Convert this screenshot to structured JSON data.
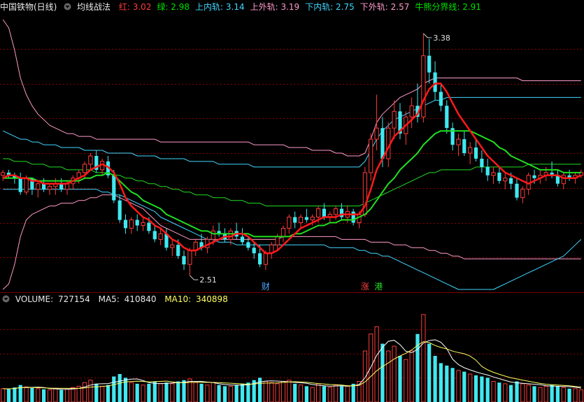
{
  "header": {
    "stock_name": "中国铁物(日线)",
    "indicator_name": "均线战法",
    "values": [
      {
        "label": "红:",
        "value": "3.02",
        "color": "#ff3c3c"
      },
      {
        "label": "绿:",
        "value": "2.98",
        "color": "#00e000"
      },
      {
        "label": "上内轨:",
        "value": "3.14",
        "color": "#40d8ff"
      },
      {
        "label": "上外轨:",
        "value": "3.19",
        "color": "#ff9ac8"
      },
      {
        "label": "下内轨:",
        "value": "2.75",
        "color": "#40d8ff"
      },
      {
        "label": "下外轨:",
        "value": "2.57",
        "color": "#ff9ac8"
      },
      {
        "label": "牛熊分界线:",
        "value": "2.91",
        "color": "#00e000"
      }
    ]
  },
  "annotations": {
    "high_label": "3.38",
    "low_label": "2.51",
    "marker_cai": "财",
    "marker_zhang": "涨",
    "marker_gang": "港"
  },
  "volume_header": {
    "volume_label": "VOLUME:",
    "volume_value": "727154",
    "ma5_label": "MA5:",
    "ma5_value": "410840",
    "ma10_label": "MA10:",
    "ma10_value": "340898"
  },
  "colors": {
    "up": "#ff3c3c",
    "down": "#40e8f0",
    "red_ma": "#ff1a1a",
    "green_ma": "#20e020",
    "inner_band": "#40d8ff",
    "outer_band": "#ff9ac8",
    "grid": "#8a0000",
    "vol_ma5": "#ffffff",
    "vol_ma10": "#ffff60"
  },
  "chart_data": {
    "type": "candlestick",
    "price_range": [
      2.45,
      3.45
    ],
    "volume_range": [
      0,
      800000
    ],
    "candles": [
      [
        2.87,
        2.89,
        2.85,
        2.88,
        110000
      ],
      [
        2.88,
        2.89,
        2.86,
        2.87,
        105000
      ],
      [
        2.87,
        2.88,
        2.84,
        2.86,
        120000
      ],
      [
        2.86,
        2.88,
        2.8,
        2.81,
        140000
      ],
      [
        2.81,
        2.87,
        2.8,
        2.86,
        125000
      ],
      [
        2.86,
        2.86,
        2.8,
        2.82,
        115000
      ],
      [
        2.82,
        2.85,
        2.79,
        2.84,
        110000
      ],
      [
        2.84,
        2.86,
        2.81,
        2.82,
        105000
      ],
      [
        2.82,
        2.84,
        2.8,
        2.83,
        100000
      ],
      [
        2.83,
        2.86,
        2.8,
        2.84,
        110000
      ],
      [
        2.84,
        2.86,
        2.81,
        2.82,
        100000
      ],
      [
        2.82,
        2.85,
        2.8,
        2.84,
        105000
      ],
      [
        2.84,
        2.87,
        2.82,
        2.86,
        120000
      ],
      [
        2.86,
        2.89,
        2.84,
        2.88,
        130000
      ],
      [
        2.88,
        2.92,
        2.86,
        2.91,
        160000
      ],
      [
        2.91,
        2.95,
        2.89,
        2.94,
        180000
      ],
      [
        2.94,
        2.96,
        2.88,
        2.89,
        150000
      ],
      [
        2.89,
        2.93,
        2.87,
        2.92,
        130000
      ],
      [
        2.92,
        2.94,
        2.86,
        2.87,
        140000
      ],
      [
        2.87,
        2.89,
        2.77,
        2.78,
        210000
      ],
      [
        2.78,
        2.8,
        2.7,
        2.71,
        230000
      ],
      [
        2.71,
        2.73,
        2.66,
        2.68,
        200000
      ],
      [
        2.68,
        2.72,
        2.66,
        2.71,
        160000
      ],
      [
        2.71,
        2.73,
        2.67,
        2.69,
        150000
      ],
      [
        2.69,
        2.72,
        2.67,
        2.7,
        140000
      ],
      [
        2.7,
        2.72,
        2.66,
        2.67,
        150000
      ],
      [
        2.67,
        2.69,
        2.63,
        2.64,
        170000
      ],
      [
        2.64,
        2.68,
        2.62,
        2.66,
        150000
      ],
      [
        2.66,
        2.68,
        2.6,
        2.61,
        160000
      ],
      [
        2.61,
        2.64,
        2.58,
        2.62,
        150000
      ],
      [
        2.62,
        2.64,
        2.57,
        2.58,
        170000
      ],
      [
        2.58,
        2.6,
        2.53,
        2.55,
        180000
      ],
      [
        2.55,
        2.61,
        2.51,
        2.6,
        190000
      ],
      [
        2.6,
        2.64,
        2.58,
        2.63,
        160000
      ],
      [
        2.63,
        2.66,
        2.6,
        2.61,
        150000
      ],
      [
        2.61,
        2.65,
        2.59,
        2.64,
        140000
      ],
      [
        2.64,
        2.69,
        2.62,
        2.67,
        160000
      ],
      [
        2.67,
        2.7,
        2.65,
        2.66,
        140000
      ],
      [
        2.66,
        2.68,
        2.63,
        2.64,
        130000
      ],
      [
        2.64,
        2.68,
        2.62,
        2.67,
        130000
      ],
      [
        2.67,
        2.7,
        2.64,
        2.65,
        140000
      ],
      [
        2.65,
        2.68,
        2.62,
        2.63,
        150000
      ],
      [
        2.63,
        2.65,
        2.6,
        2.61,
        160000
      ],
      [
        2.61,
        2.63,
        2.57,
        2.59,
        180000
      ],
      [
        2.59,
        2.62,
        2.54,
        2.55,
        200000
      ],
      [
        2.55,
        2.6,
        2.53,
        2.59,
        170000
      ],
      [
        2.59,
        2.63,
        2.57,
        2.62,
        160000
      ],
      [
        2.62,
        2.66,
        2.6,
        2.65,
        150000
      ],
      [
        2.65,
        2.69,
        2.63,
        2.68,
        170000
      ],
      [
        2.68,
        2.73,
        2.66,
        2.72,
        180000
      ],
      [
        2.72,
        2.74,
        2.68,
        2.7,
        150000
      ],
      [
        2.7,
        2.73,
        2.68,
        2.72,
        140000
      ],
      [
        2.72,
        2.75,
        2.7,
        2.71,
        130000
      ],
      [
        2.71,
        2.73,
        2.69,
        2.72,
        120000
      ],
      [
        2.72,
        2.76,
        2.7,
        2.75,
        150000
      ],
      [
        2.75,
        2.77,
        2.71,
        2.72,
        130000
      ],
      [
        2.72,
        2.74,
        2.7,
        2.73,
        120000
      ],
      [
        2.73,
        2.76,
        2.71,
        2.75,
        140000
      ],
      [
        2.75,
        2.77,
        2.71,
        2.72,
        130000
      ],
      [
        2.72,
        2.76,
        2.7,
        2.74,
        130000
      ],
      [
        2.74,
        2.75,
        2.69,
        2.7,
        150000
      ],
      [
        2.7,
        2.74,
        2.68,
        2.73,
        170000
      ],
      [
        2.73,
        2.9,
        2.72,
        2.88,
        420000
      ],
      [
        2.88,
        3.02,
        2.85,
        3.0,
        560000
      ],
      [
        3.0,
        3.16,
        2.96,
        3.04,
        620000
      ],
      [
        3.04,
        3.08,
        2.9,
        2.93,
        480000
      ],
      [
        2.93,
        3.06,
        2.9,
        3.04,
        420000
      ],
      [
        3.04,
        3.14,
        3.0,
        3.1,
        460000
      ],
      [
        3.1,
        3.13,
        3.0,
        3.02,
        380000
      ],
      [
        3.02,
        3.1,
        2.98,
        3.08,
        350000
      ],
      [
        3.08,
        3.15,
        3.04,
        3.12,
        420000
      ],
      [
        3.12,
        3.2,
        3.06,
        3.08,
        560000
      ],
      [
        3.08,
        3.38,
        3.06,
        3.3,
        720000
      ],
      [
        3.3,
        3.36,
        3.2,
        3.24,
        480000
      ],
      [
        3.24,
        3.28,
        3.14,
        3.17,
        380000
      ],
      [
        3.17,
        3.2,
        3.1,
        3.12,
        320000
      ],
      [
        3.12,
        3.14,
        3.02,
        3.04,
        300000
      ],
      [
        3.04,
        3.06,
        2.96,
        2.98,
        280000
      ],
      [
        2.98,
        3.02,
        2.94,
        3.0,
        260000
      ],
      [
        3.0,
        3.03,
        2.94,
        2.95,
        250000
      ],
      [
        2.95,
        2.99,
        2.91,
        2.97,
        230000
      ],
      [
        2.97,
        3.0,
        2.92,
        2.93,
        220000
      ],
      [
        2.93,
        2.96,
        2.88,
        2.9,
        210000
      ],
      [
        2.9,
        2.93,
        2.85,
        2.87,
        200000
      ],
      [
        2.87,
        2.9,
        2.84,
        2.88,
        170000
      ],
      [
        2.88,
        2.9,
        2.84,
        2.85,
        160000
      ],
      [
        2.85,
        2.88,
        2.82,
        2.86,
        150000
      ],
      [
        2.86,
        2.88,
        2.82,
        2.84,
        140000
      ],
      [
        2.84,
        2.86,
        2.78,
        2.79,
        170000
      ],
      [
        2.79,
        2.83,
        2.77,
        2.82,
        150000
      ],
      [
        2.82,
        2.88,
        2.8,
        2.87,
        140000
      ],
      [
        2.87,
        2.89,
        2.84,
        2.86,
        130000
      ],
      [
        2.86,
        2.89,
        2.84,
        2.87,
        120000
      ],
      [
        2.87,
        2.9,
        2.85,
        2.88,
        130000
      ],
      [
        2.88,
        2.92,
        2.86,
        2.87,
        140000
      ],
      [
        2.87,
        2.89,
        2.83,
        2.84,
        130000
      ],
      [
        2.84,
        2.88,
        2.82,
        2.87,
        120000
      ],
      [
        2.87,
        2.89,
        2.85,
        2.86,
        110000
      ],
      [
        2.86,
        2.88,
        2.84,
        2.87,
        110000
      ],
      [
        2.87,
        2.89,
        2.86,
        2.88,
        100000
      ]
    ],
    "red_ma": [
      2.86,
      2.87,
      2.87,
      2.86,
      2.86,
      2.85,
      2.85,
      2.84,
      2.84,
      2.84,
      2.84,
      2.84,
      2.85,
      2.86,
      2.87,
      2.89,
      2.9,
      2.91,
      2.9,
      2.88,
      2.84,
      2.79,
      2.76,
      2.74,
      2.72,
      2.71,
      2.69,
      2.68,
      2.66,
      2.64,
      2.63,
      2.61,
      2.6,
      2.6,
      2.61,
      2.62,
      2.63,
      2.64,
      2.65,
      2.65,
      2.66,
      2.66,
      2.65,
      2.63,
      2.61,
      2.59,
      2.59,
      2.6,
      2.62,
      2.64,
      2.66,
      2.68,
      2.69,
      2.7,
      2.71,
      2.72,
      2.72,
      2.72,
      2.73,
      2.73,
      2.73,
      2.73,
      2.76,
      2.82,
      2.89,
      2.93,
      2.97,
      3.01,
      3.03,
      3.05,
      3.07,
      3.09,
      3.14,
      3.18,
      3.2,
      3.2,
      3.17,
      3.13,
      3.09,
      3.06,
      3.03,
      3.0,
      2.97,
      2.94,
      2.92,
      2.9,
      2.88,
      2.87,
      2.86,
      2.85,
      2.84,
      2.85,
      2.86,
      2.87,
      2.87,
      2.87,
      2.86,
      2.86,
      2.86,
      2.87
    ],
    "green_ma": [
      2.86,
      2.86,
      2.86,
      2.86,
      2.86,
      2.86,
      2.85,
      2.85,
      2.85,
      2.85,
      2.85,
      2.85,
      2.85,
      2.85,
      2.86,
      2.86,
      2.87,
      2.87,
      2.88,
      2.87,
      2.85,
      2.83,
      2.81,
      2.8,
      2.78,
      2.77,
      2.76,
      2.75,
      2.73,
      2.72,
      2.71,
      2.7,
      2.69,
      2.68,
      2.67,
      2.67,
      2.66,
      2.66,
      2.66,
      2.66,
      2.66,
      2.66,
      2.66,
      2.65,
      2.65,
      2.65,
      2.65,
      2.65,
      2.65,
      2.65,
      2.66,
      2.66,
      2.67,
      2.68,
      2.69,
      2.69,
      2.7,
      2.7,
      2.71,
      2.71,
      2.71,
      2.72,
      2.73,
      2.75,
      2.78,
      2.81,
      2.84,
      2.86,
      2.89,
      2.91,
      2.93,
      2.95,
      2.98,
      3.0,
      3.02,
      3.03,
      3.03,
      3.03,
      3.03,
      3.03,
      3.03,
      3.02,
      3.01,
      3.0,
      2.99,
      2.97,
      2.96,
      2.94,
      2.93,
      2.92,
      2.91,
      2.9,
      2.89,
      2.89,
      2.89,
      2.89,
      2.88,
      2.88,
      2.88,
      2.88
    ],
    "upper_outer_band": [
      3.43,
      3.4,
      3.32,
      3.22,
      3.16,
      3.12,
      3.09,
      3.07,
      3.05,
      3.04,
      3.03,
      3.02,
      3.02,
      3.01,
      3.01,
      3.01,
      3.0,
      3.0,
      3.0,
      3.0,
      3.0,
      3.0,
      3.0,
      3.0,
      3.0,
      3.0,
      3.0,
      2.99,
      2.99,
      2.99,
      2.99,
      2.99,
      2.99,
      2.99,
      2.99,
      2.99,
      2.99,
      2.99,
      2.99,
      2.99,
      2.99,
      2.99,
      2.99,
      2.98,
      2.98,
      2.98,
      2.98,
      2.98,
      2.98,
      2.97,
      2.97,
      2.97,
      2.97,
      2.96,
      2.96,
      2.96,
      2.96,
      2.95,
      2.95,
      2.94,
      2.94,
      2.94,
      2.95,
      3.0,
      3.06,
      3.09,
      3.11,
      3.13,
      3.15,
      3.16,
      3.17,
      3.18,
      3.2,
      3.21,
      3.22,
      3.22,
      3.22,
      3.22,
      3.22,
      3.22,
      3.22,
      3.22,
      3.22,
      3.22,
      3.22,
      3.22,
      3.22,
      3.22,
      3.22,
      3.21,
      3.21,
      3.21,
      3.21,
      3.21,
      3.21,
      3.21,
      3.21,
      3.21,
      3.21,
      3.21
    ],
    "upper_inner_band": [
      3.03,
      3.02,
      3.01,
      3.0,
      3.0,
      2.99,
      2.99,
      2.98,
      2.98,
      2.98,
      2.97,
      2.97,
      2.97,
      2.97,
      2.96,
      2.96,
      2.96,
      2.96,
      2.95,
      2.95,
      2.95,
      2.95,
      2.95,
      2.94,
      2.94,
      2.94,
      2.94,
      2.93,
      2.93,
      2.93,
      2.93,
      2.93,
      2.92,
      2.92,
      2.92,
      2.92,
      2.92,
      2.91,
      2.91,
      2.91,
      2.91,
      2.91,
      2.91,
      2.9,
      2.9,
      2.9,
      2.9,
      2.9,
      2.9,
      2.9,
      2.9,
      2.9,
      2.9,
      2.9,
      2.9,
      2.9,
      2.9,
      2.9,
      2.9,
      2.9,
      2.9,
      2.9,
      2.92,
      2.96,
      3.0,
      3.03,
      3.05,
      3.07,
      3.08,
      3.09,
      3.1,
      3.11,
      3.12,
      3.13,
      3.14,
      3.14,
      3.15,
      3.15,
      3.15,
      3.15,
      3.15,
      3.15,
      3.15,
      3.15,
      3.15,
      3.15,
      3.15,
      3.15,
      3.15,
      3.15,
      3.15,
      3.15,
      3.15,
      3.15,
      3.15,
      3.15,
      3.15,
      3.15,
      3.15,
      3.15
    ],
    "lower_inner_band": [
      2.82,
      2.82,
      2.82,
      2.82,
      2.82,
      2.82,
      2.82,
      2.82,
      2.82,
      2.82,
      2.82,
      2.82,
      2.82,
      2.82,
      2.82,
      2.82,
      2.82,
      2.81,
      2.81,
      2.8,
      2.8,
      2.79,
      2.78,
      2.77,
      2.76,
      2.75,
      2.74,
      2.72,
      2.71,
      2.7,
      2.69,
      2.68,
      2.67,
      2.66,
      2.65,
      2.64,
      2.64,
      2.63,
      2.63,
      2.63,
      2.62,
      2.62,
      2.62,
      2.62,
      2.62,
      2.62,
      2.62,
      2.62,
      2.62,
      2.62,
      2.62,
      2.62,
      2.62,
      2.62,
      2.62,
      2.62,
      2.61,
      2.61,
      2.61,
      2.61,
      2.61,
      2.6,
      2.6,
      2.59,
      2.59,
      2.58,
      2.58,
      2.57,
      2.56,
      2.55,
      2.54,
      2.53,
      2.52,
      2.51,
      2.5,
      2.49,
      2.48,
      2.47,
      2.46,
      2.46,
      2.46,
      2.46,
      2.46,
      2.46,
      2.46,
      2.47,
      2.48,
      2.49,
      2.5,
      2.51,
      2.52,
      2.53,
      2.54,
      2.55,
      2.56,
      2.57,
      2.58,
      2.6,
      2.62,
      2.64
    ],
    "lower_outer_band": [
      2.46,
      2.48,
      2.55,
      2.65,
      2.71,
      2.73,
      2.74,
      2.75,
      2.76,
      2.76,
      2.77,
      2.77,
      2.77,
      2.78,
      2.78,
      2.79,
      2.79,
      2.8,
      2.8,
      2.8,
      2.79,
      2.78,
      2.77,
      2.76,
      2.75,
      2.73,
      2.71,
      2.69,
      2.68,
      2.67,
      2.66,
      2.65,
      2.64,
      2.64,
      2.64,
      2.64,
      2.64,
      2.64,
      2.64,
      2.64,
      2.64,
      2.64,
      2.64,
      2.64,
      2.64,
      2.64,
      2.64,
      2.64,
      2.65,
      2.65,
      2.65,
      2.65,
      2.65,
      2.65,
      2.65,
      2.65,
      2.65,
      2.65,
      2.64,
      2.64,
      2.64,
      2.64,
      2.64,
      2.63,
      2.63,
      2.63,
      2.63,
      2.62,
      2.62,
      2.62,
      2.61,
      2.61,
      2.61,
      2.6,
      2.6,
      2.59,
      2.59,
      2.58,
      2.58,
      2.57,
      2.57,
      2.57,
      2.57,
      2.57,
      2.57,
      2.57,
      2.57,
      2.57,
      2.57,
      2.57,
      2.57,
      2.57,
      2.57,
      2.57,
      2.57,
      2.57,
      2.57,
      2.57,
      2.57,
      2.57
    ],
    "bull_bear_line": [
      2.93,
      2.93,
      2.92,
      2.92,
      2.92,
      2.91,
      2.91,
      2.91,
      2.9,
      2.9,
      2.9,
      2.89,
      2.89,
      2.89,
      2.89,
      2.89,
      2.88,
      2.88,
      2.88,
      2.87,
      2.87,
      2.86,
      2.86,
      2.85,
      2.85,
      2.84,
      2.84,
      2.83,
      2.83,
      2.82,
      2.82,
      2.81,
      2.81,
      2.8,
      2.8,
      2.8,
      2.79,
      2.79,
      2.79,
      2.78,
      2.78,
      2.78,
      2.77,
      2.77,
      2.77,
      2.76,
      2.76,
      2.76,
      2.76,
      2.76,
      2.76,
      2.76,
      2.76,
      2.76,
      2.76,
      2.76,
      2.76,
      2.76,
      2.76,
      2.76,
      2.76,
      2.76,
      2.77,
      2.78,
      2.79,
      2.8,
      2.81,
      2.82,
      2.83,
      2.84,
      2.85,
      2.86,
      2.87,
      2.88,
      2.88,
      2.89,
      2.89,
      2.89,
      2.89,
      2.89,
      2.89,
      2.9,
      2.9,
      2.9,
      2.9,
      2.9,
      2.9,
      2.9,
      2.9,
      2.9,
      2.91,
      2.91,
      2.91,
      2.91,
      2.91,
      2.91,
      2.91,
      2.91,
      2.91,
      2.91
    ],
    "high_point": {
      "index": 72,
      "value": 3.38
    },
    "low_point": {
      "index": 32,
      "value": 2.51
    }
  }
}
